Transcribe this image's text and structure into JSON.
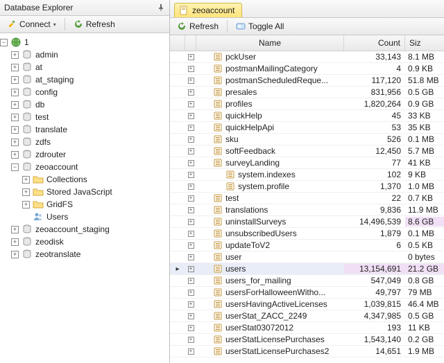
{
  "left": {
    "title": "Database Explorer",
    "toolbar": {
      "connect": "Connect",
      "refresh": "Refresh"
    },
    "rootLabel": "1",
    "nodes": [
      {
        "label": "admin",
        "exp": "+",
        "icon": "db"
      },
      {
        "label": "at",
        "exp": "+",
        "icon": "db"
      },
      {
        "label": "at_staging",
        "exp": "+",
        "icon": "db"
      },
      {
        "label": "config",
        "exp": "+",
        "icon": "db"
      },
      {
        "label": "db",
        "exp": "+",
        "icon": "db"
      },
      {
        "label": "test",
        "exp": "+",
        "icon": "db"
      },
      {
        "label": "translate",
        "exp": "+",
        "icon": "db"
      },
      {
        "label": "zdfs",
        "exp": "+",
        "icon": "db"
      },
      {
        "label": "zdrouter",
        "exp": "+",
        "icon": "db"
      },
      {
        "label": "zeoaccount",
        "exp": "−",
        "icon": "db",
        "children": [
          {
            "label": "Collections",
            "exp": "+",
            "icon": "folder"
          },
          {
            "label": "Stored JavaScript",
            "exp": "+",
            "icon": "folder"
          },
          {
            "label": "GridFS",
            "exp": "+",
            "icon": "folder"
          },
          {
            "label": "Users",
            "exp": "",
            "icon": "users"
          }
        ]
      },
      {
        "label": "zeoaccount_staging",
        "exp": "+",
        "icon": "db"
      },
      {
        "label": "zeodisk",
        "exp": "+",
        "icon": "db"
      },
      {
        "label": "zeotranslate",
        "exp": "+",
        "icon": "db"
      }
    ]
  },
  "right": {
    "tab": "zeoaccount",
    "toolbar": {
      "refresh": "Refresh",
      "toggleAll": "Toggle All"
    },
    "columns": {
      "name": "Name",
      "count": "Count",
      "size": "Siz"
    },
    "rows": [
      {
        "name": "pckUser",
        "count": "33,143",
        "size": "8.1 MB"
      },
      {
        "name": "postmanMailingCategory",
        "count": "4",
        "size": "0.9 KB"
      },
      {
        "name": "postmanScheduledReque...",
        "count": "117,120",
        "size": "51.8 MB"
      },
      {
        "name": "presales",
        "count": "831,956",
        "size": "0.5 GB"
      },
      {
        "name": "profiles",
        "count": "1,820,264",
        "size": "0.9 GB"
      },
      {
        "name": "quickHelp",
        "count": "45",
        "size": "33 KB"
      },
      {
        "name": "quickHelpApi",
        "count": "53",
        "size": "35 KB"
      },
      {
        "name": "sku",
        "count": "526",
        "size": "0.1 MB"
      },
      {
        "name": "softFeedback",
        "count": "12,450",
        "size": "5.7 MB"
      },
      {
        "name": "surveyLanding",
        "count": "77",
        "size": "41 KB"
      },
      {
        "name": "system.indexes",
        "count": "102",
        "size": "9 KB",
        "indent": true
      },
      {
        "name": "system.profile",
        "count": "1,370",
        "size": "1.0 MB",
        "indent": true
      },
      {
        "name": "test",
        "count": "22",
        "size": "0.7 KB"
      },
      {
        "name": "translations",
        "count": "9,836",
        "size": "11.9 MB"
      },
      {
        "name": "uninstallSurveys",
        "count": "14,496,539",
        "size": "8.6 GB",
        "hlsize": true
      },
      {
        "name": "unsubscribedUsers",
        "count": "1,879",
        "size": "0.1 MB"
      },
      {
        "name": "updateToV2",
        "count": "6",
        "size": "0.5 KB"
      },
      {
        "name": "user",
        "count": "",
        "size": "0 bytes"
      },
      {
        "name": "users",
        "count": "13,154,691",
        "size": "21.2 GB",
        "selected": true,
        "hlcount": true,
        "hlsize": true
      },
      {
        "name": "users_for_mailing",
        "count": "547,049",
        "size": "0.8 GB"
      },
      {
        "name": "usersForHalloweenWitho...",
        "count": "49,797",
        "size": "79 MB"
      },
      {
        "name": "usersHavingActiveLicenses",
        "count": "1,039,815",
        "size": "46.4 MB"
      },
      {
        "name": "userStat_ZACC_2249",
        "count": "4,347,985",
        "size": "0.5 GB"
      },
      {
        "name": "userStat03072012",
        "count": "193",
        "size": "11 KB"
      },
      {
        "name": "userStatLicensePurchases",
        "count": "1,543,140",
        "size": "0.2 GB"
      },
      {
        "name": "userStatLicensePurchases2",
        "count": "14,651",
        "size": "1.9 MB"
      }
    ]
  }
}
